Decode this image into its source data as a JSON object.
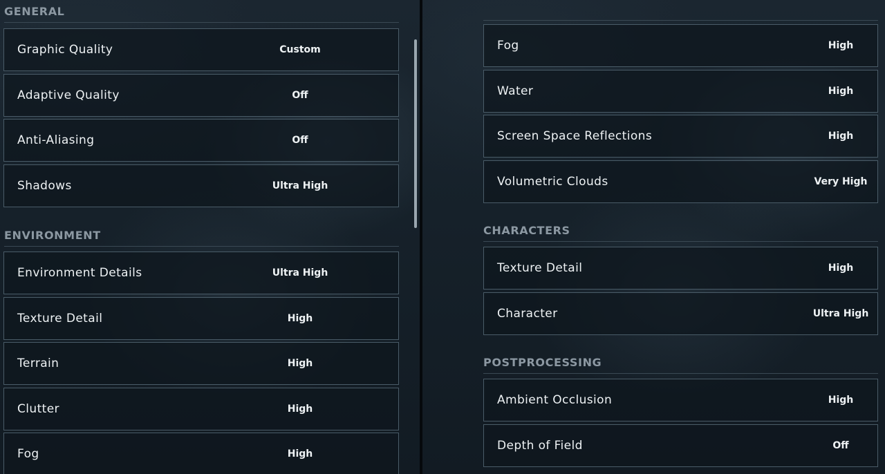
{
  "left_panel": {
    "sections": [
      {
        "header": "GENERAL",
        "rows": [
          {
            "label": "Graphic Quality",
            "value": "Custom"
          },
          {
            "label": "Adaptive Quality",
            "value": "Off"
          },
          {
            "label": "Anti-Aliasing",
            "value": "Off"
          },
          {
            "label": "Shadows",
            "value": "Ultra High"
          }
        ]
      },
      {
        "header": "ENVIRONMENT",
        "rows": [
          {
            "label": "Environment Details",
            "value": "Ultra High"
          },
          {
            "label": "Texture Detail",
            "value": "High"
          },
          {
            "label": "Terrain",
            "value": "High"
          },
          {
            "label": "Clutter",
            "value": "High"
          },
          {
            "label": "Fog",
            "value": "High"
          }
        ]
      }
    ]
  },
  "right_panel": {
    "sections": [
      {
        "header": "",
        "rows": [
          {
            "label": "Fog",
            "value": "High"
          },
          {
            "label": "Water",
            "value": "High"
          },
          {
            "label": "Screen Space Reflections",
            "value": "High"
          },
          {
            "label": "Volumetric Clouds",
            "value": "Very High"
          }
        ]
      },
      {
        "header": "CHARACTERS",
        "rows": [
          {
            "label": "Texture Detail",
            "value": "High"
          },
          {
            "label": "Character",
            "value": "Ultra High"
          }
        ]
      },
      {
        "header": "POSTPROCESSING",
        "rows": [
          {
            "label": "Ambient Occlusion",
            "value": "High"
          },
          {
            "label": "Depth of Field",
            "value": "Off"
          }
        ]
      }
    ]
  },
  "colors": {
    "background": "#16212a",
    "row_border": "#4a5c68",
    "header_text": "#8c98a2",
    "text": "#eef2f4"
  }
}
